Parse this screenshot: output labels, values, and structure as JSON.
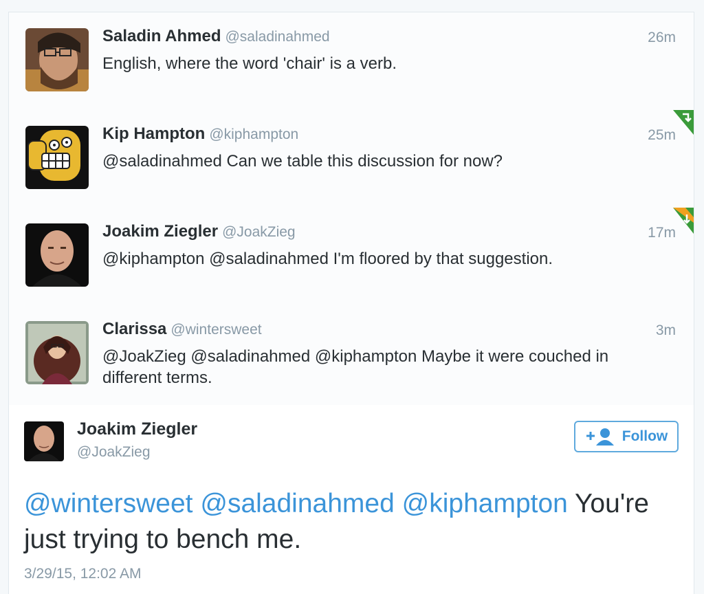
{
  "tweets": [
    {
      "name": "Saladin Ahmed",
      "handle": "@saladinahmed",
      "time": "26m",
      "text": "English, where the word 'chair' is a verb."
    },
    {
      "name": "Kip Hampton",
      "handle": "@kiphampton",
      "time": "25m",
      "text": "@saladinahmed Can we table this discussion for now?"
    },
    {
      "name": "Joakim Ziegler",
      "handle": "@JoakZieg",
      "time": "17m",
      "text": "@kiphampton @saladinahmed I'm floored by that suggestion."
    },
    {
      "name": "Clarissa",
      "handle": "@wintersweet",
      "time": "3m",
      "text": "@JoakZieg @saladinahmed @kiphampton Maybe it were couched in different terms."
    }
  ],
  "focus": {
    "name": "Joakim Ziegler",
    "handle": "@JoakZieg",
    "follow_label": "Follow",
    "mentions": [
      "@wintersweet",
      "@saladinahmed",
      "@kiphampton"
    ],
    "text": "You're just trying to bench me.",
    "date": "3/29/15, 12:02 AM"
  },
  "colors": {
    "link": "#3b94d9",
    "retweet_corner": "#3a9b3a",
    "favorite_corner": "#f0a020"
  },
  "icons": {
    "retweet_corner": "retweet-corner-icon",
    "favorite_corner": "favorite-corner-icon",
    "follow": "add-user-icon"
  }
}
